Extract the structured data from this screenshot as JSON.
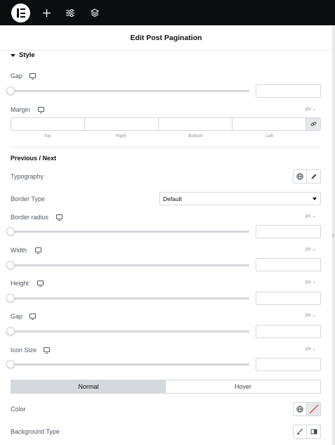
{
  "topbar": {
    "logo_icon": "elementor-logo-icon",
    "add_icon": "plus-icon",
    "settings_icon": "sliders-icon",
    "structure_icon": "layers-icon"
  },
  "header": {
    "title": "Edit Post Pagination"
  },
  "style_section": {
    "title": "Style"
  },
  "gap": {
    "label": "Gap",
    "value": ""
  },
  "margin": {
    "label": "Margin",
    "unit": "px",
    "sides": [
      "Top",
      "Right",
      "Bottom",
      "Left"
    ]
  },
  "prevnext": {
    "title": "Previous / Next"
  },
  "typography": {
    "label": "Typography"
  },
  "border_type": {
    "label": "Border Type",
    "value": "Default"
  },
  "border_radius": {
    "label": "Border radius",
    "unit": "px",
    "value": ""
  },
  "width": {
    "label": "Width",
    "unit": "px",
    "value": ""
  },
  "height": {
    "label": "Height",
    "unit": "px",
    "value": ""
  },
  "gap2": {
    "label": "Gap",
    "unit": "px",
    "value": ""
  },
  "icon_size": {
    "label": "Icon Size",
    "unit": "px",
    "value": ""
  },
  "state_tabs": {
    "normal": "Normal",
    "hover": "Hover"
  },
  "color": {
    "label": "Color"
  },
  "background_type": {
    "label": "Background Type"
  },
  "colors": {
    "topbar": "#0c0d0e",
    "active_tab": "#d5d8dc",
    "clear_red": "#d72b3f"
  }
}
